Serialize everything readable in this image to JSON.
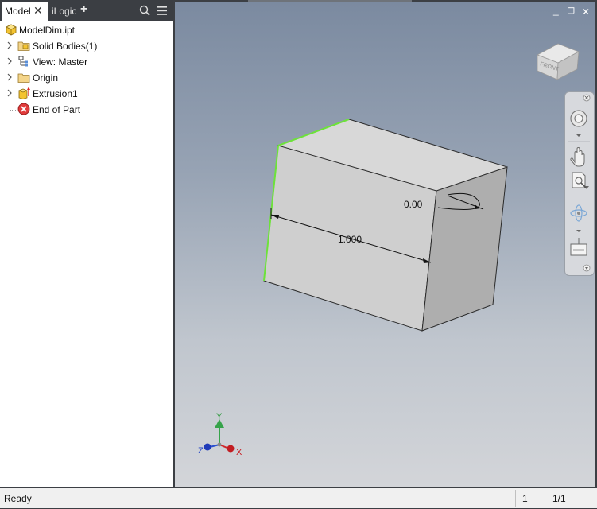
{
  "tabs": {
    "model": "Model",
    "ilogic": "iLogic",
    "add": "+"
  },
  "tree": {
    "root": "ModelDim.ipt",
    "items": [
      {
        "label": "Solid Bodies(1)",
        "icon": "folder-solid-bodies-icon"
      },
      {
        "label": "View: Master",
        "icon": "view-rep-icon"
      },
      {
        "label": "Origin",
        "icon": "folder-icon"
      },
      {
        "label": "Extrusion1",
        "icon": "extrusion-icon"
      },
      {
        "label": "End of Part",
        "icon": "end-of-part-icon"
      }
    ]
  },
  "viewport": {
    "dimension_length": "1.000",
    "dimension_angle": "0.00",
    "viewcube_face": "FRONT",
    "triad": {
      "x": "X",
      "y": "Y",
      "z": "Z"
    }
  },
  "status": {
    "text": "Ready",
    "count": "1",
    "pages": "1/1"
  },
  "colors": {
    "panel_bg": "#3b3e43",
    "selected_edge": "#6de23a",
    "axis_x": "#d0262a",
    "axis_y": "#36a34a",
    "axis_z": "#2b4fcf"
  }
}
